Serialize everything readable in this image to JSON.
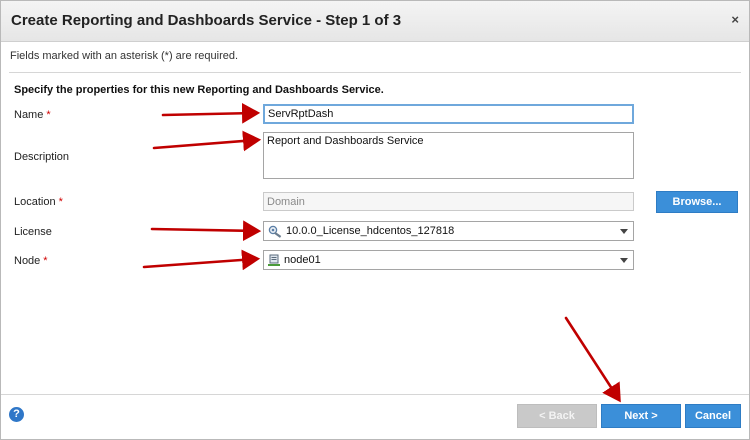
{
  "dialog": {
    "title": "Create Reporting and Dashboards Service - Step 1 of 3",
    "close_glyph": "×",
    "required_note": "Fields marked with an asterisk (*) are required.",
    "section_heading": "Specify the properties for this new Reporting and Dashboards Service."
  },
  "form": {
    "name": {
      "label": "Name",
      "required_mark": "*",
      "value": "ServRptDash"
    },
    "description": {
      "label": "Description",
      "value": "Report and Dashboards Service"
    },
    "location": {
      "label": "Location",
      "required_mark": "*",
      "value": "Domain",
      "browse_label": "Browse..."
    },
    "license": {
      "label": "License",
      "value": "10.0.0_License_hdcentos_127818",
      "icon": "license-key-icon"
    },
    "node": {
      "label": "Node",
      "required_mark": "*",
      "value": "node01",
      "icon": "node-server-icon"
    }
  },
  "footer": {
    "help_glyph": "?",
    "back_label": "< Back",
    "next_label": "Next >",
    "cancel_label": "Cancel"
  },
  "colors": {
    "primary_button": "#3b8fd9",
    "disabled_button": "#c9c9c9",
    "annotation_arrow": "#c00000",
    "required_mark": "#d00000"
  }
}
